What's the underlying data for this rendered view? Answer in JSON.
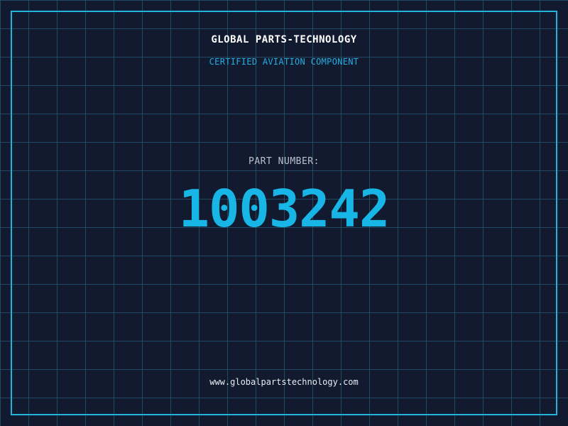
{
  "header": {
    "company": "GLOBAL PARTS-TECHNOLOGY",
    "tagline": "CERTIFIED AVIATION COMPONENT"
  },
  "part": {
    "label": "PART NUMBER:",
    "number": "1003242"
  },
  "footer": {
    "website": "www.globalpartstechnology.com"
  },
  "colors": {
    "background": "#111a2e",
    "grid": "#306e8c",
    "frame": "#1fb3dd",
    "accent": "#17b6e6",
    "title": "#ffffff",
    "label": "#b8c3cf"
  }
}
